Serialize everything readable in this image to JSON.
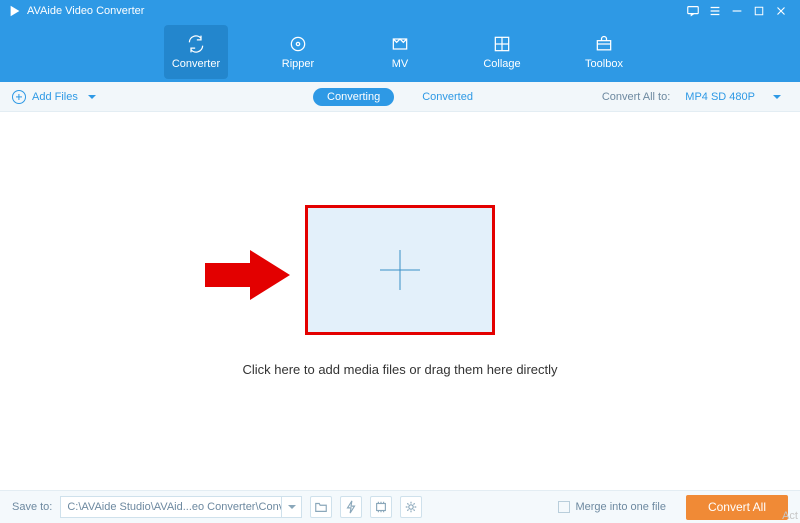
{
  "titlebar": {
    "app_name": "AVAide Video Converter"
  },
  "nav": {
    "items": [
      {
        "label": "Converter"
      },
      {
        "label": "Ripper"
      },
      {
        "label": "MV"
      },
      {
        "label": "Collage"
      },
      {
        "label": "Toolbox"
      }
    ]
  },
  "subbar": {
    "add_files_label": "Add Files",
    "tabs": {
      "converting": "Converting",
      "converted": "Converted"
    },
    "convert_all_label": "Convert All to:",
    "selected_format": "MP4 SD 480P"
  },
  "main": {
    "hint_text": "Click here to add media files or drag them here directly"
  },
  "bottombar": {
    "save_to_label": "Save to:",
    "save_path": "C:\\AVAide Studio\\AVAid...eo Converter\\Converted",
    "merge_label": "Merge into one file",
    "convert_all_btn": "Convert All"
  },
  "watermark": "Act"
}
